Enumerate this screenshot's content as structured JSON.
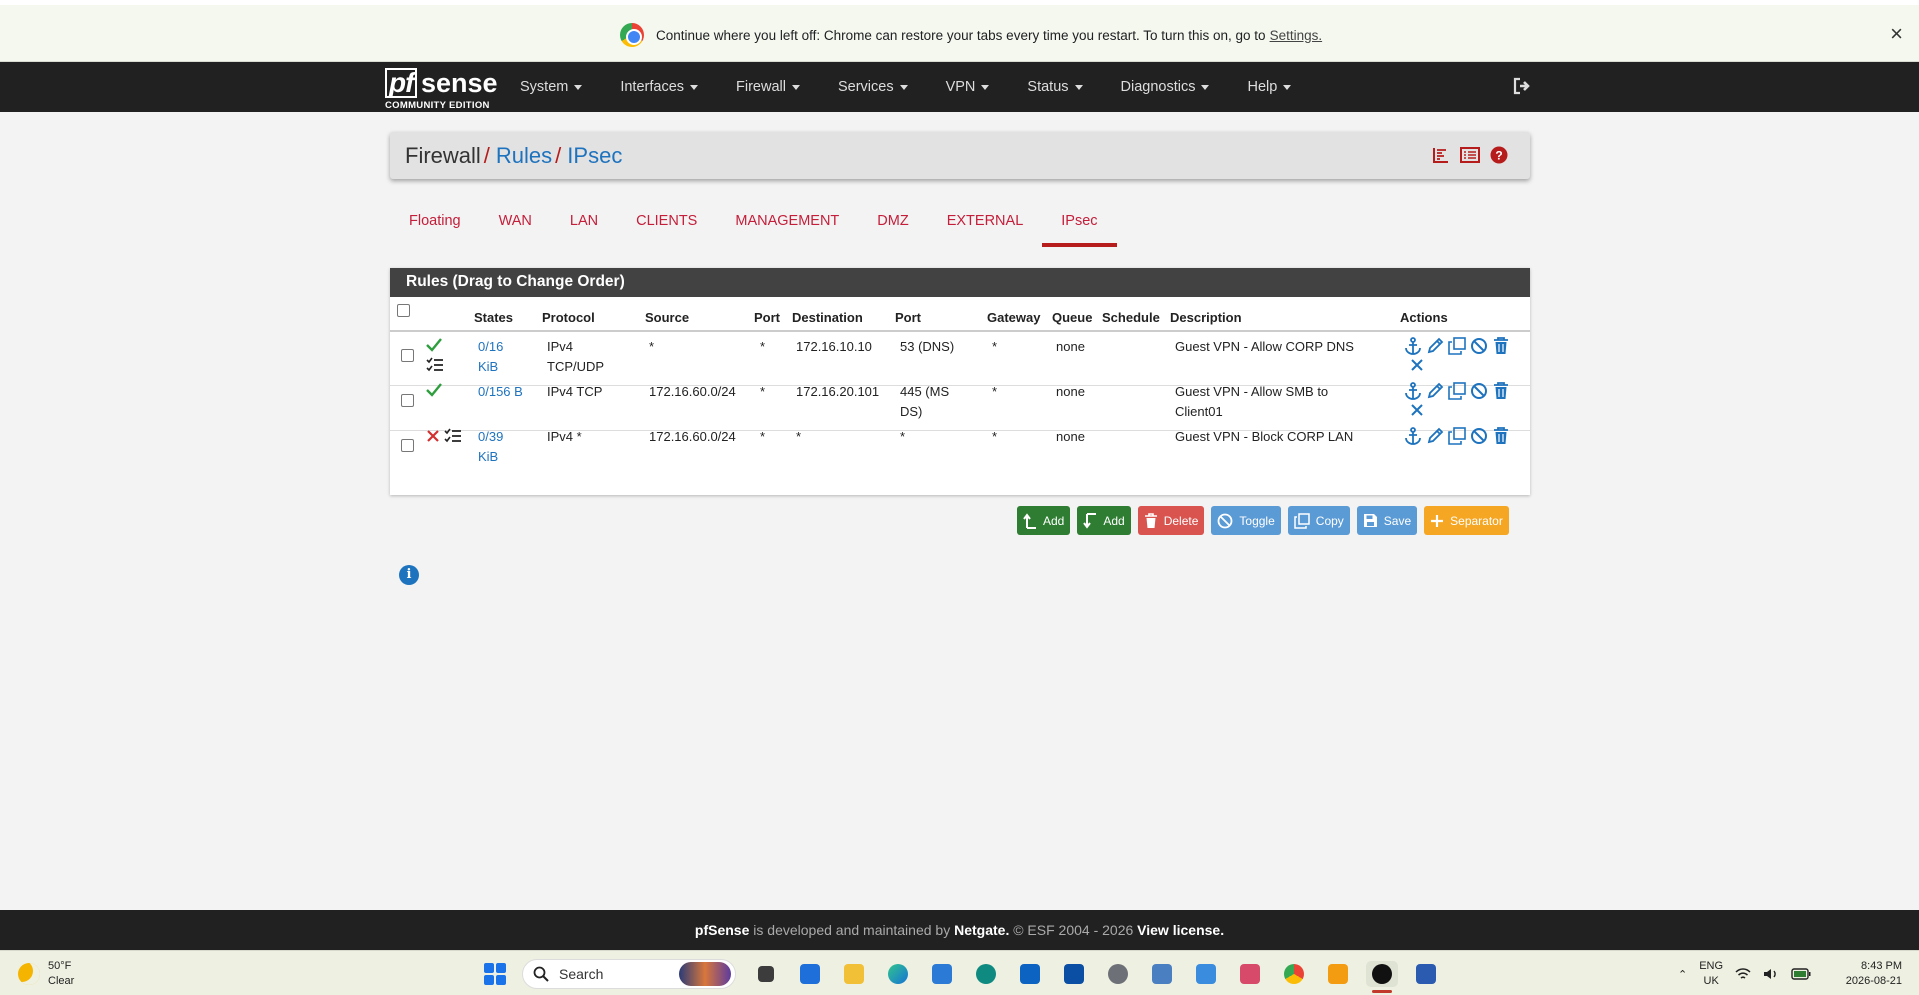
{
  "chrome_bar": {
    "message": "Continue where you left off: Chrome can restore your tabs every time you restart. To turn this on, go to",
    "settings_link": "Settings.",
    "close_glyph": "×"
  },
  "brand": {
    "pf": "pf",
    "sense": "sense",
    "edition": "COMMUNITY EDITION"
  },
  "nav": {
    "items": [
      "System",
      "Interfaces",
      "Firewall",
      "Services",
      "VPN",
      "Status",
      "Diagnostics",
      "Help"
    ]
  },
  "breadcrumb": {
    "first": "Firewall",
    "sep1": "/",
    "second": "Rules",
    "sep2": "/",
    "third": "IPsec"
  },
  "tabs": [
    "Floating",
    "WAN",
    "LAN",
    "CLIENTS",
    "MANAGEMENT",
    "DMZ",
    "EXTERNAL",
    "IPsec"
  ],
  "active_tab": "IPsec",
  "rules": {
    "heading": "Rules (Drag to Change Order)",
    "columns": {
      "states": "States",
      "protocol": "Protocol",
      "source": "Source",
      "port": "Port",
      "destination": "Destination",
      "dport": "Port",
      "gateway": "Gateway",
      "queue": "Queue",
      "schedule": "Schedule",
      "description": "Description",
      "actions": "Actions"
    },
    "rows": [
      {
        "status": "pass",
        "has_log": true,
        "states_1": "0/16",
        "states_2": "KiB",
        "proto_1": "IPv4",
        "proto_2": "TCP/UDP",
        "source": "*",
        "sport": "*",
        "destination": "172.16.10.10",
        "dport_1": "53 (DNS)",
        "dport_2": "",
        "gateway": "*",
        "queue": "none",
        "schedule": "",
        "desc_1": "Guest VPN - Allow CORP DNS",
        "desc_2": ""
      },
      {
        "status": "pass",
        "has_log": false,
        "states_1": "0/156 B",
        "states_2": "",
        "proto_1": "IPv4 TCP",
        "proto_2": "",
        "source": "172.16.60.0/24",
        "sport": "*",
        "destination": "172.16.20.101",
        "dport_1": "445 (MS",
        "dport_2": "DS)",
        "gateway": "*",
        "queue": "none",
        "schedule": "",
        "desc_1": "Guest VPN - Allow SMB to",
        "desc_2": "Client01"
      },
      {
        "status": "block",
        "has_log": true,
        "states_1": "0/39",
        "states_2": "KiB",
        "proto_1": "IPv4 *",
        "proto_2": "",
        "source": "172.16.60.0/24",
        "sport": "*",
        "destination": "*",
        "dport_1": "*",
        "dport_2": "",
        "gateway": "*",
        "queue": "none",
        "schedule": "",
        "desc_1": "Guest VPN - Block CORP LAN",
        "desc_2": ""
      }
    ]
  },
  "buttons": {
    "add_top": "Add",
    "add_bottom": "Add",
    "delete": "Delete",
    "toggle": "Toggle",
    "copy": "Copy",
    "save": "Save",
    "separator": "Separator"
  },
  "info_glyph": "i",
  "footer": {
    "brand": "pfSense",
    "text1": " is developed and maintained by ",
    "company": "Netgate.",
    "text2": " © ESF 2004 - 2026 ",
    "license": "View license."
  },
  "taskbar": {
    "temp": "50°F",
    "condition": "Clear",
    "search": "Search",
    "lang_1": "ENG",
    "lang_2": "UK",
    "time": "8:43 PM",
    "date": "2026-08-21"
  },
  "colors": {
    "accent_red": "#b71c1c",
    "link_blue": "#1e73be",
    "pass_green": "#2e9e3f",
    "block_red": "#d32f2f"
  }
}
